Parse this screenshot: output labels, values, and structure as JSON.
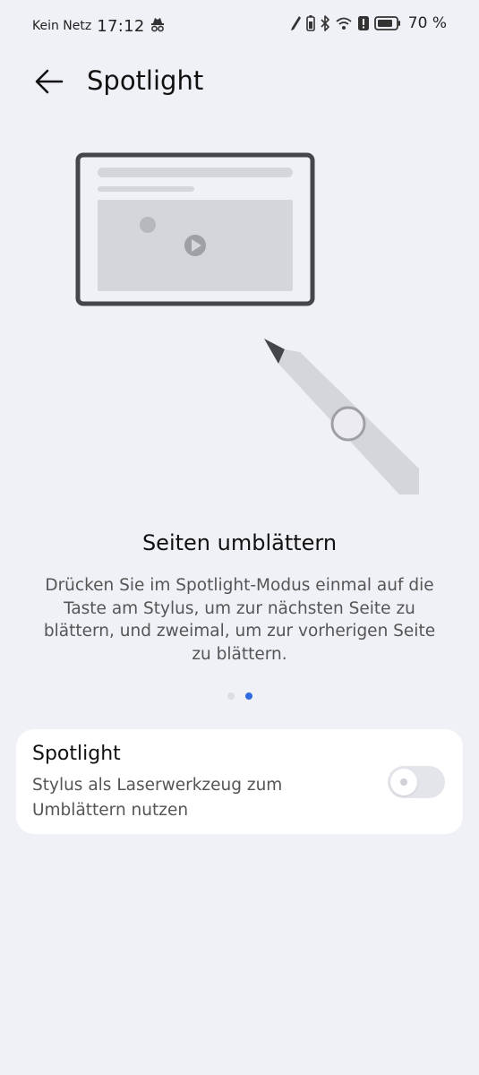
{
  "status_bar": {
    "carrier": "Kein Netz",
    "time": "17:12",
    "battery_percent": "70 %",
    "icons": [
      "incognito-icon",
      "stylus-icon",
      "stylus-battery-icon",
      "bluetooth-icon",
      "wifi-icon",
      "alert-icon",
      "battery-icon"
    ]
  },
  "header": {
    "title": "Spotlight",
    "back_icon": "arrow-left-icon"
  },
  "illustration": {
    "description_icons": [
      "tablet-icon",
      "play-icon",
      "stylus-pen-icon"
    ]
  },
  "tutorial": {
    "heading": "Seiten umblättern",
    "description": "Drücken Sie im Spotlight-Modus einmal auf die Taste am Stylus, um zur nächsten Seite zu blättern, und zweimal, um zur vorherigen Seite zu blättern.",
    "page_count": 2,
    "active_page": 2
  },
  "setting": {
    "title": "Spotlight",
    "subtitle": "Stylus als Laserwerkzeug zum Umblättern nutzen",
    "enabled": false
  },
  "colors": {
    "background": "#f0f1f6",
    "card": "#ffffff",
    "accent": "#2f6bdf",
    "toggle_off": "#e4e5ea"
  }
}
